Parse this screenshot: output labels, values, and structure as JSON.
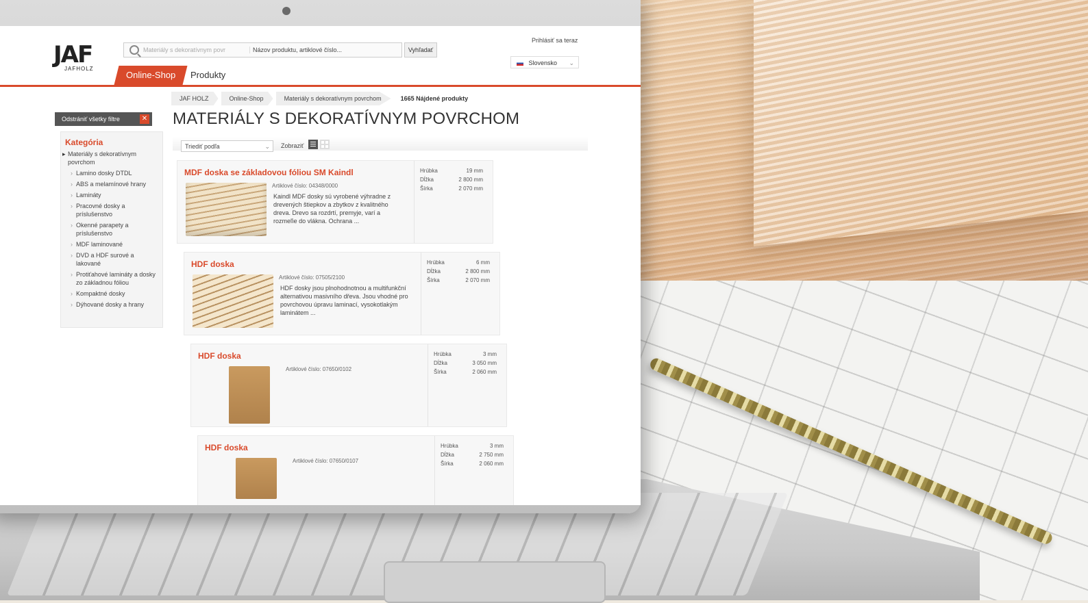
{
  "app": {
    "logo_text": "JAF",
    "logo_sub": "JAFHOLZ",
    "search_placeholder_left": "Materiály s dekoratívnym povr",
    "search_placeholder_right": "Názov produktu, artiklové číslo...",
    "search_button": "Vyhľadať",
    "login": "Prihlásiť sa teraz",
    "language": "Slovensko",
    "tabs": [
      "Online-Shop",
      "Produkty"
    ]
  },
  "breadcrumb": [
    "JAF HOLZ",
    "Online-Shop",
    "Materiály s dekoratívnym povrchom"
  ],
  "result_count": "1665 Nájdené produkty",
  "sidebar": {
    "clear_filters": "Odstrániť všetky filtre",
    "heading": "Kategória",
    "root": "Materiály s dekoratívnym povrchom",
    "items": [
      "Lamino dosky DTDL",
      "ABS a melamínové hrany",
      "Lamináty",
      "Pracovné dosky a príslušenstvo",
      "Okenné parapety a príslušenstvo",
      "MDF laminované",
      "DVD a HDF surové a lakované",
      "Protiťahové lamináty a dosky zo základnou fóliou",
      "Kompaktné dosky",
      "Dýhované dosky a hrany"
    ]
  },
  "main": {
    "title": "MATERIÁLY S DEKORATÍVNYM POVRCHOM",
    "sort_label": "Triediť podľa",
    "view_label": "Zobraziť"
  },
  "products": [
    {
      "title": "MDF doska se základovou fóliou SM Kaindl",
      "article": "Artiklové číslo: 04348/0000",
      "description": "Kaindl MDF dosky sú vyrobené výhradne z drevených štiepkov a zbytkov z kvalitného dreva. Drevo sa rozdrtí, premyje, varí a rozmeľie do vlákna. Ochrana ...",
      "specs": [
        {
          "label": "Hrúbka",
          "value": "19 mm"
        },
        {
          "label": "Dĺžka",
          "value": "2 800 mm"
        },
        {
          "label": "Šírka",
          "value": "2 070 mm"
        }
      ]
    },
    {
      "title": "HDF doska",
      "article": "Artiklové číslo: 07505/2100",
      "description": "HDF dosky jsou plnohodnotnou a multifunkční alternativou masivního dřeva. Jsou vhodné pro povrchovou úpravu laminací, vysokotlakým laminátem ...",
      "specs": [
        {
          "label": "Hrúbka",
          "value": "6 mm"
        },
        {
          "label": "Dĺžka",
          "value": "2 800 mm"
        },
        {
          "label": "Šírka",
          "value": "2 070 mm"
        }
      ]
    },
    {
      "title": "HDF doska",
      "article": "Artiklové číslo: 07650/0102",
      "description": "",
      "specs": [
        {
          "label": "Hrúbka",
          "value": "3 mm"
        },
        {
          "label": "Dĺžka",
          "value": "3 050 mm"
        },
        {
          "label": "Šírka",
          "value": "2 060 mm"
        }
      ]
    },
    {
      "title": "HDF doska",
      "article": "Artiklové číslo: 07650/0107",
      "description": "",
      "specs": [
        {
          "label": "Hrúbka",
          "value": "3 mm"
        },
        {
          "label": "Dĺžka",
          "value": "2 750 mm"
        },
        {
          "label": "Šírka",
          "value": "2 060 mm"
        }
      ]
    }
  ]
}
